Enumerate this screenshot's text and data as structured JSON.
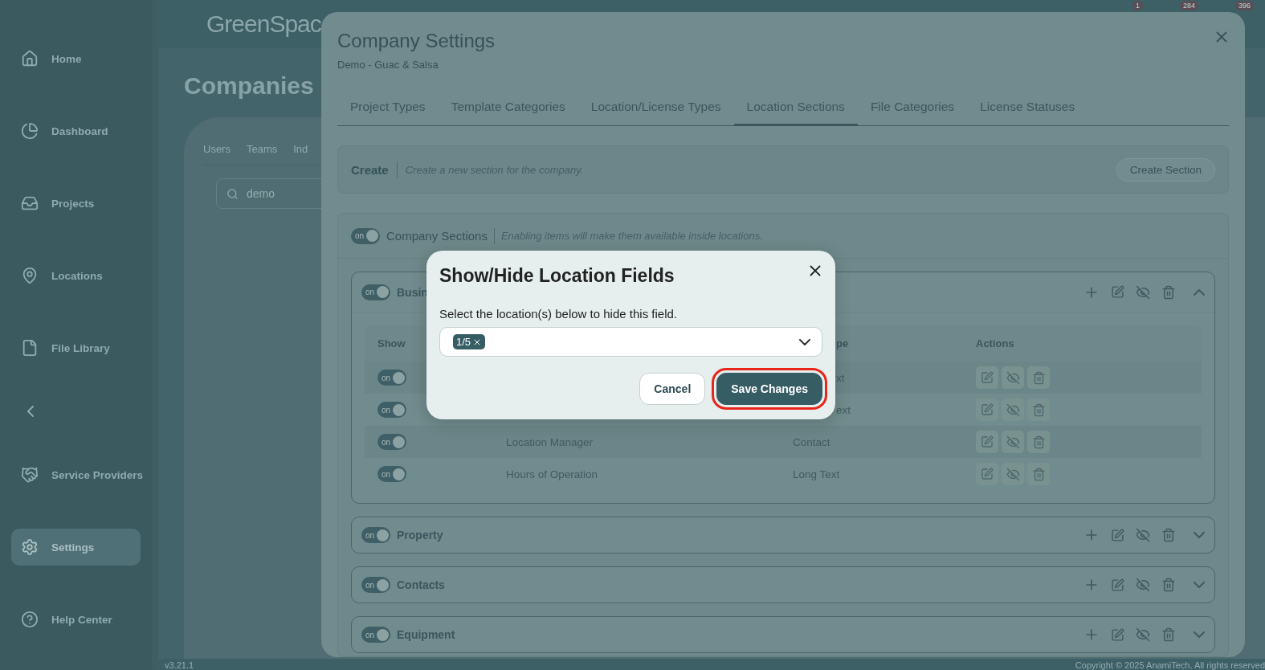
{
  "sidebar": {
    "items": [
      {
        "kind": "link",
        "label": "Home",
        "selected": false
      },
      {
        "kind": "link",
        "label": "Dashboard",
        "selected": false
      },
      {
        "kind": "link",
        "label": "Projects",
        "selected": false
      },
      {
        "kind": "link",
        "label": "Locations",
        "selected": false
      },
      {
        "kind": "link",
        "label": "File Library",
        "selected": false
      },
      {
        "kind": "collapse"
      },
      {
        "kind": "link",
        "label": "Service Providers",
        "selected": false
      },
      {
        "kind": "link",
        "label": "Settings",
        "selected": true
      },
      {
        "kind": "link",
        "label": "Help Center",
        "selected": false
      }
    ]
  },
  "header": {
    "logo": "GreenSpac",
    "badges": [
      "1",
      "284",
      "396"
    ]
  },
  "page": {
    "title": "Companies",
    "tabs": [
      {
        "label": "Users",
        "selected": false
      },
      {
        "label": "Teams",
        "selected": false
      },
      {
        "label": "Ind",
        "selected": false
      }
    ],
    "search": {
      "value": "demo"
    }
  },
  "footer": {
    "version": "v3.21.1",
    "copyright": "Copyright © 2025 AnamiTech. All rights reserved"
  },
  "settings": {
    "title": "Company Settings",
    "subtitle": "Demo - Guac & Salsa",
    "tabs": [
      {
        "label": "Project Types",
        "selected": false
      },
      {
        "label": "Template Categories",
        "selected": false
      },
      {
        "label": "Location/License Types",
        "selected": false
      },
      {
        "label": "Location Sections",
        "selected": true
      },
      {
        "label": "File Categories",
        "selected": false
      },
      {
        "label": "License Statuses",
        "selected": false
      }
    ],
    "create": {
      "title": "Create",
      "hint": "Create a new section for the company.",
      "button": "Create Section"
    },
    "company_sections": {
      "toggle": {
        "on": true,
        "label": "on"
      },
      "title": "Company Sections",
      "hint": "Enabling items will make them available inside locations."
    },
    "sections": [
      {
        "title": "Busin",
        "toggle": {
          "on": true,
          "label": "on"
        },
        "expanded": true,
        "table": {
          "columns": [
            {
              "label": "Show"
            },
            {
              "label": "pe"
            },
            {
              "label": "Actions"
            }
          ],
          "rows": [
            {
              "toggle": {
                "on": true,
                "label": "on"
              },
              "type": "xt"
            },
            {
              "toggle": {
                "on": true,
                "label": "on"
              },
              "type": "ext"
            },
            {
              "toggle": {
                "on": true,
                "label": "on"
              },
              "name": "Location Manager",
              "type": "Contact"
            },
            {
              "toggle": {
                "on": true,
                "label": "on"
              },
              "name": "Hours of Operation",
              "type": "Long Text"
            }
          ]
        }
      },
      {
        "title": "Property",
        "toggle": {
          "on": true,
          "label": "on"
        },
        "expanded": false
      },
      {
        "title": "Contacts",
        "toggle": {
          "on": true,
          "label": "on"
        },
        "expanded": false
      },
      {
        "title": "Equipment",
        "toggle": {
          "on": true,
          "label": "on"
        },
        "expanded": false
      }
    ]
  },
  "dialog": {
    "title": "Show/Hide Location Fields",
    "label": "Select the location(s) below to hide this field.",
    "tags": [
      "1/5"
    ],
    "buttons": [
      {
        "kind": "secondary",
        "label": "Cancel",
        "highlighted": false
      },
      {
        "kind": "primary",
        "label": "Save Changes",
        "highlighted": true
      }
    ]
  }
}
